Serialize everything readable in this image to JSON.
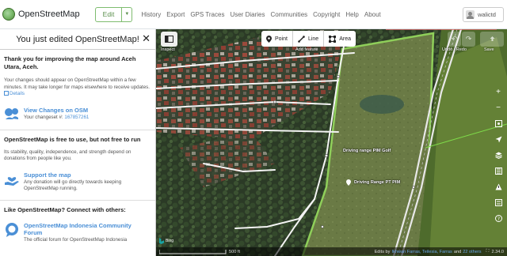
{
  "brand": {
    "name": "OpenStreetMap"
  },
  "nav": {
    "edit_label": "Edit",
    "links": [
      "History",
      "Export",
      "GPS Traces",
      "User Diaries",
      "Communities",
      "Copyright",
      "Help",
      "About"
    ],
    "user": "walictd"
  },
  "sidebar": {
    "title": "You just edited OpenStreetMap!",
    "lead": "Thank you for improving the map around Aceh Utara, Aceh.",
    "note": "Your changes should appear on OpenStreetMap within a few minutes. It may take longer for maps elsewhere to receive updates.",
    "details_link": "Details",
    "view_changes": "View Changes on OSM",
    "changeset_label": "Your changeset #:",
    "changeset_id": "167857261",
    "free_heading": "OpenStreetMap is free to use, but not free to run",
    "free_text": "Its stability, quality, independence, and strength depend on donations from people like you.",
    "support_title": "Support the map",
    "support_text": "Any donation will go directly towards keeping OpenStreetMap running.",
    "connect_heading": "Like OpenStreetMap? Connect with others:",
    "community_title": "OpenStreetMap Indonesia Community Forum",
    "community_text": "The official forum for OpenStreetMap Indonesia"
  },
  "map": {
    "inspect_label": "Inspect",
    "modes": [
      "Point",
      "Line",
      "Area"
    ],
    "add_feature_label": "Add feature",
    "undo_redo_label": "Undo / Redo",
    "save_label": "Save",
    "label_golf_1": "Driving range PIM Golf",
    "label_golf_2": "Driving Range PT PIM",
    "imagery": "Bing",
    "scale": "500 ft",
    "edits_by": "Edits by",
    "editors": "Ikhwan Farras, Teilesia, Farras",
    "and_label": "and",
    "others": "22 others",
    "version": "2.34.0"
  },
  "colors": {
    "accent_green": "#7ebc6f",
    "link_blue": "#4a8fd6"
  }
}
